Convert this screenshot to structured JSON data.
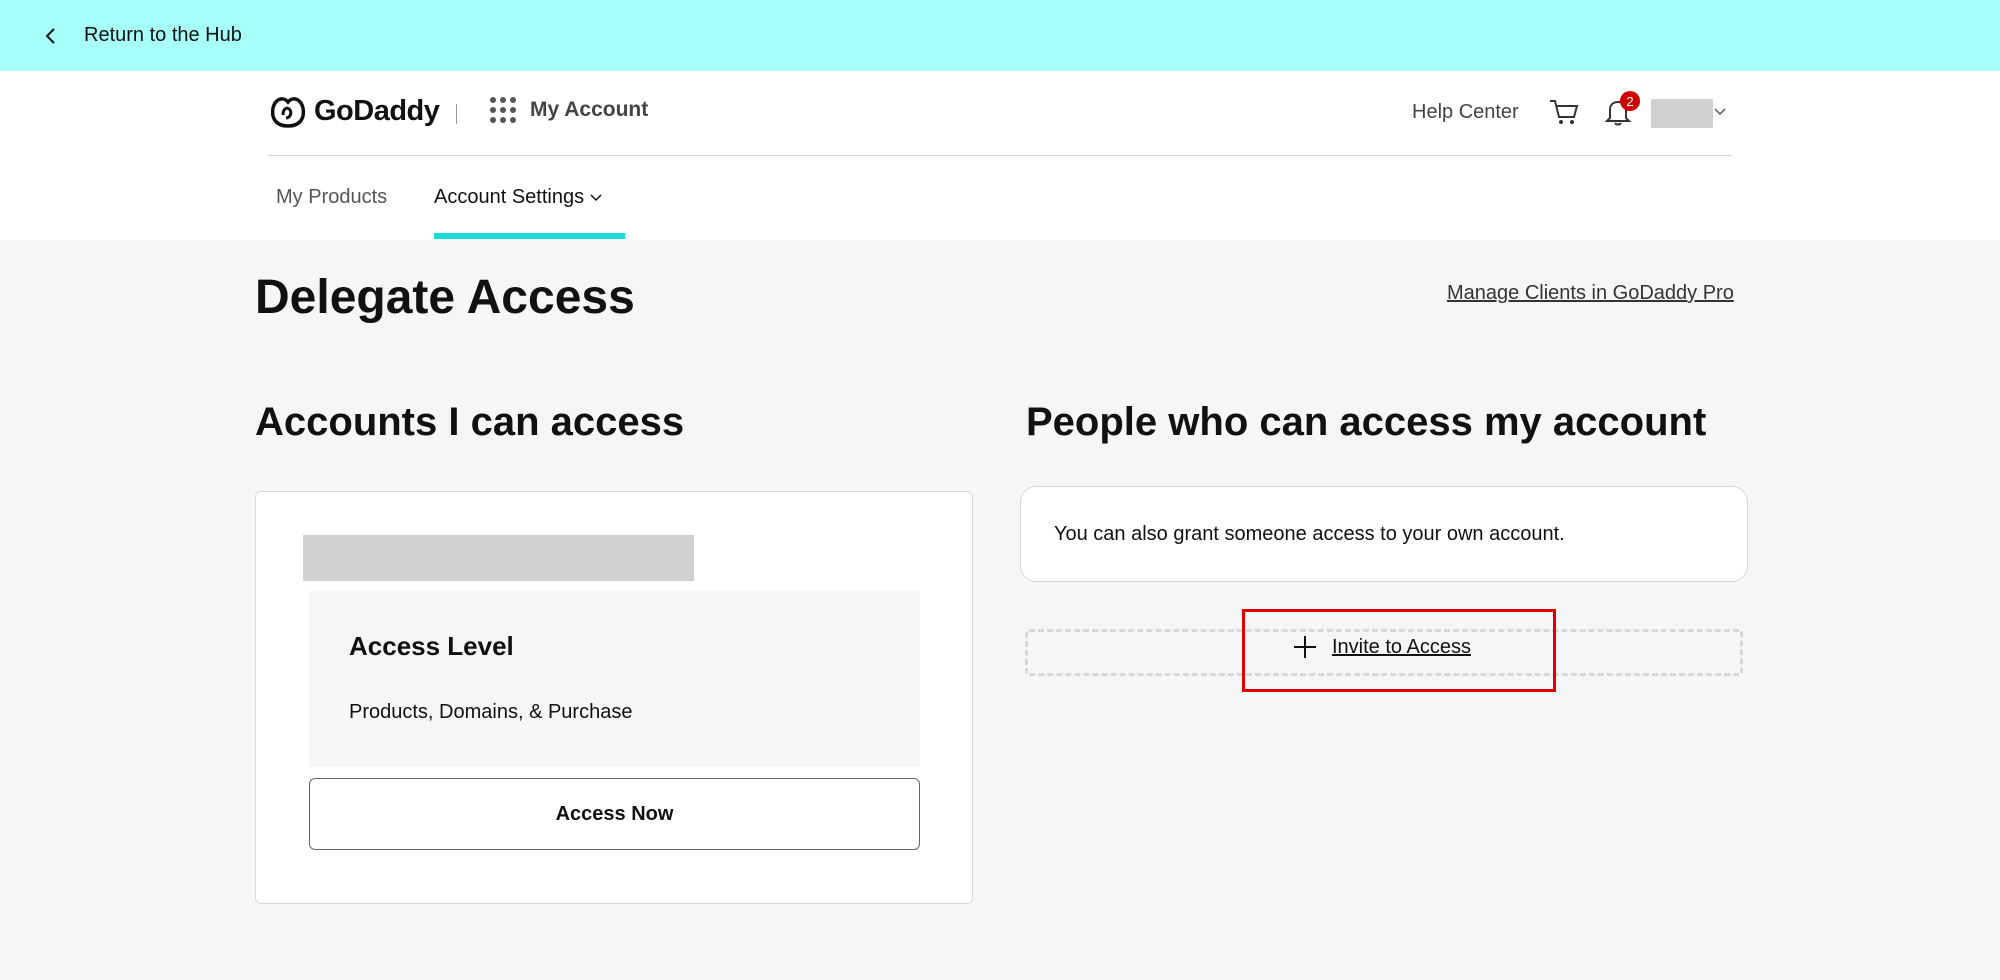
{
  "hub_bar": {
    "return_label": "Return to the Hub"
  },
  "header": {
    "brand": "GoDaddy",
    "my_account_label": "My Account",
    "help_center_label": "Help Center",
    "notification_count": "2",
    "tabs": [
      {
        "label": "My Products"
      },
      {
        "label": "Account Settings"
      }
    ]
  },
  "main": {
    "page_title": "Delegate Access",
    "manage_link": "Manage Clients in GoDaddy Pro",
    "left": {
      "heading": "Accounts I can access",
      "access_level_title": "Access Level",
      "access_level_value": "Products, Domains, & Purchase",
      "access_now_label": "Access Now"
    },
    "right": {
      "heading": "People who can access my account",
      "info_text": "You can also grant someone access to your own account.",
      "invite_label": "Invite to Access"
    }
  },
  "colors": {
    "hub_bar": "#a6fff8",
    "tab_underline": "#1bdbdb",
    "badge": "#d10000",
    "highlight": "#e00000",
    "page_bg": "#f5f6f8"
  },
  "icons": [
    "chevron-left-icon",
    "godaddy-logo-icon",
    "apps-grid-icon",
    "cart-icon",
    "bell-icon",
    "chevron-down-icon",
    "plus-icon"
  ]
}
